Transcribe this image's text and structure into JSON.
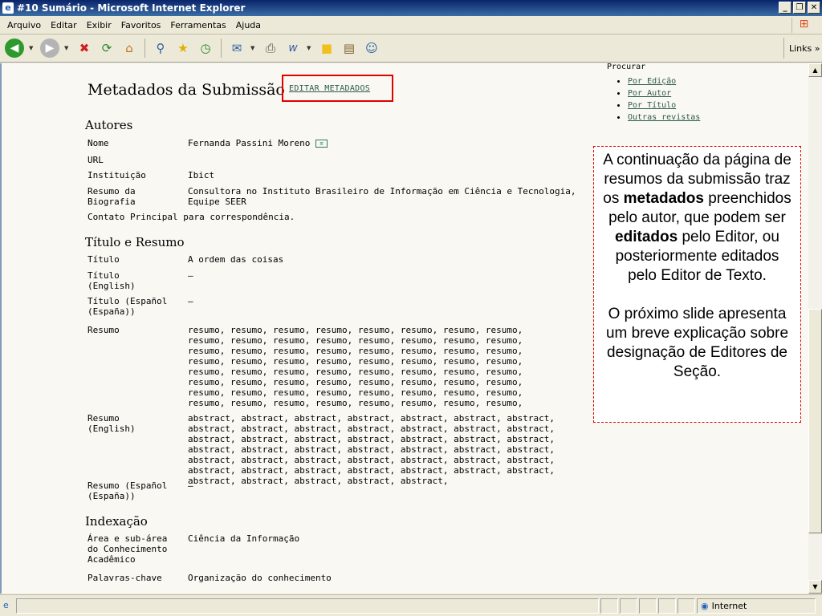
{
  "window": {
    "title": "#10 Sumário - Microsoft Internet Explorer"
  },
  "menu": [
    "Arquivo",
    "Editar",
    "Exibir",
    "Favoritos",
    "Ferramentas",
    "Ajuda"
  ],
  "toolbar": {
    "links_label": "Links"
  },
  "page": {
    "title": "Metadados da Submissão",
    "edit_link": "EDITAR METADADOS",
    "authors": {
      "heading": "Autores",
      "fields": [
        {
          "label": "Nome",
          "value": "Fernanda Passini Moreno"
        },
        {
          "label": "URL",
          "value": ""
        },
        {
          "label": "Instituição",
          "value": "Ibict"
        },
        {
          "label": "Resumo da Biografia",
          "value": "Consultora no Instituto Brasileiro de Informação em Ciência e Tecnologia, Equipe SEER"
        }
      ],
      "contact": "Contato Principal para correspondência."
    },
    "title_abstract": {
      "heading": "Título e Resumo",
      "fields": [
        {
          "label": "Título",
          "value": "A ordem das coisas"
        },
        {
          "label": "Título (English)",
          "value": "—"
        },
        {
          "label": "Título (Español (España))",
          "value": "—"
        },
        {
          "label": "Resumo",
          "value": "resumo, resumo, resumo, resumo, resumo, resumo, resumo, resumo, resumo, resumo, resumo, resumo, resumo, resumo, resumo, resumo, resumo, resumo, resumo, resumo, resumo, resumo, resumo, resumo, resumo, resumo, resumo, resumo, resumo, resumo, resumo, resumo, resumo, resumo, resumo, resumo, resumo, resumo, resumo, resumo, resumo, resumo, resumo, resumo, resumo, resumo, resumo, resumo, resumo, resumo, resumo, resumo, resumo, resumo, resumo, resumo, resumo, resumo, resumo, resumo, resumo, resumo, resumo, resumo,"
        },
        {
          "label": "Resumo (English)",
          "value": "abstract, abstract, abstract, abstract, abstract, abstract, abstract, abstract, abstract, abstract, abstract, abstract, abstract, abstract, abstract, abstract, abstract, abstract, abstract, abstract, abstract, abstract, abstract, abstract, abstract, abstract, abstract, abstract, abstract, abstract, abstract, abstract, abstract, abstract, abstract, abstract, abstract, abstract, abstract, abstract, abstract, abstract, abstract, abstract, abstract, abstract, abstract,"
        },
        {
          "label": "Resumo (Español (España))",
          "value": "—"
        }
      ]
    },
    "indexing": {
      "heading": "Indexação",
      "fields": [
        {
          "label": "Área e sub-área do Conhecimento Acadêmico",
          "value": "Ciência da Informação"
        },
        {
          "label": "Palavras-chave",
          "value": "Organização do conhecimento"
        }
      ]
    }
  },
  "sidebar": {
    "heading": "Procurar",
    "links": [
      "Por Edição",
      "Por Autor",
      "Por Título",
      "Outras revistas"
    ]
  },
  "note": {
    "p1_a": "A continuação da página de resumos da submissão traz os ",
    "p1_b": "metadados",
    "p1_c": " preenchidos pelo autor, que podem ser ",
    "p1_d": "editados",
    "p1_e": " pelo Editor, ou posteriormente editados pelo Editor de Texto.",
    "p2": "O próximo slide apresenta um breve explicação sobre designação de Editores de Seção."
  },
  "status": {
    "zone": "Internet"
  }
}
